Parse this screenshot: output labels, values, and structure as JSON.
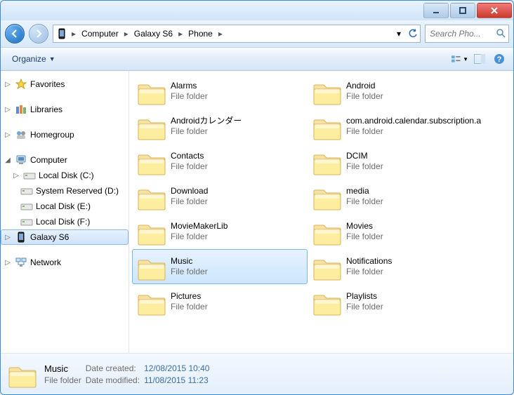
{
  "breadcrumb": {
    "root": "Computer",
    "device": "Galaxy S6",
    "folder": "Phone"
  },
  "search": {
    "placeholder": "Search Pho..."
  },
  "toolbar": {
    "organize": "Organize"
  },
  "sidebar": {
    "favorites": "Favorites",
    "libraries": "Libraries",
    "homegroup": "Homegroup",
    "computer": "Computer",
    "driveC": "Local Disk (C:)",
    "driveD": "System Reserved (D:)",
    "driveE": "Local Disk (E:)",
    "driveF": "Local Disk (F:)",
    "phone": "Galaxy S6",
    "network": "Network"
  },
  "folders": [
    {
      "name": "Alarms",
      "type": "File folder"
    },
    {
      "name": "Android",
      "type": "File folder"
    },
    {
      "name": "Androidカレンダー",
      "type": "File folder"
    },
    {
      "name": "com.android.calendar.subscription.a",
      "type": "File folder"
    },
    {
      "name": "Contacts",
      "type": "File folder"
    },
    {
      "name": "DCIM",
      "type": "File folder"
    },
    {
      "name": "Download",
      "type": "File folder"
    },
    {
      "name": "media",
      "type": "File folder"
    },
    {
      "name": "MovieMakerLib",
      "type": "File folder"
    },
    {
      "name": "Movies",
      "type": "File folder"
    },
    {
      "name": "Music",
      "type": "File folder",
      "selected": true
    },
    {
      "name": "Notifications",
      "type": "File folder"
    },
    {
      "name": "Pictures",
      "type": "File folder"
    },
    {
      "name": "Playlists",
      "type": "File folder"
    }
  ],
  "details": {
    "name": "Music",
    "type": "File folder",
    "createdLabel": "Date created:",
    "created": "12/08/2015 10:40",
    "modifiedLabel": "Date modified:",
    "modified": "11/08/2015 11:23"
  }
}
